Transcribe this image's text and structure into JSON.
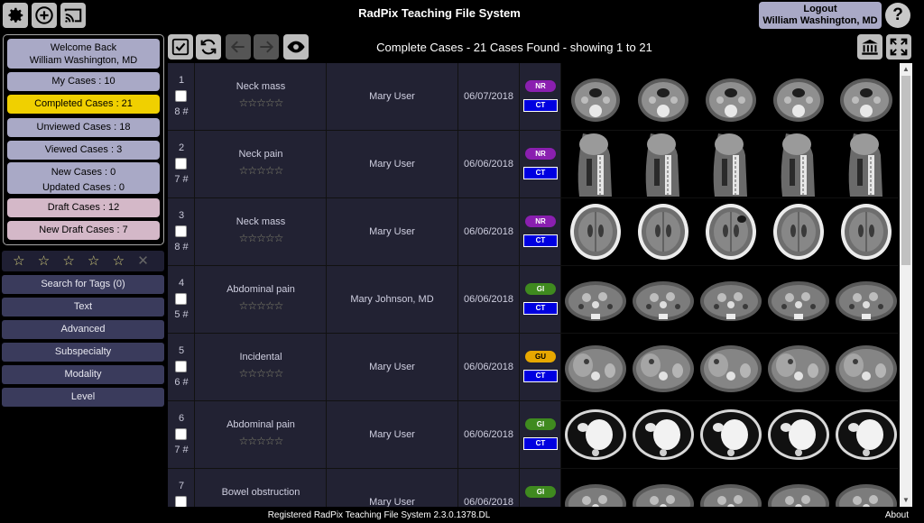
{
  "app": {
    "title": "RadPix Teaching File System"
  },
  "top_icons": [
    "gear-icon",
    "plus-circle-icon",
    "cast-icon"
  ],
  "user": {
    "logout_label": "Logout",
    "name": "William Washington, MD",
    "help_label": "?"
  },
  "sidebar": {
    "welcome": "Welcome Back",
    "welcome_name": "William Washington, MD",
    "my_cases": "My Cases : 10",
    "completed": "Completed Cases : 21",
    "unviewed": "Unviewed Cases : 18",
    "viewed": "Viewed Cases : 3",
    "new_cases": "New Cases : 0",
    "updated_cases": "Updated Cases : 0",
    "draft": "Draft Cases : 12",
    "new_draft": "New Draft Cases : 7",
    "stars": "☆ ☆ ☆ ☆ ☆",
    "clear": "✕",
    "filters": [
      "Search for Tags (0)",
      "Text",
      "Advanced",
      "Subspecialty",
      "Modality",
      "Level"
    ]
  },
  "toolbar": {
    "header": "Complete Cases - 21 Cases Found - showing 1 to 21",
    "icons": [
      "checkbox-icon",
      "refresh-icon",
      "arrow-left-icon",
      "arrow-right-icon",
      "eye-icon",
      "library-icon",
      "fullscreen-icon"
    ]
  },
  "colors": {
    "NR": "#8a1fb0",
    "GI": "#3f8a1f",
    "GU": "#e8a800",
    "modality": "#0000e0",
    "active": "#f0d000"
  },
  "cases": [
    {
      "num": "1",
      "count": "8 #",
      "title": "Neck mass",
      "rating": "☆☆☆☆☆",
      "user": "Mary User",
      "date": "06/07/2018",
      "tag": "NR",
      "modality": "CT",
      "thumb": "neck-axial"
    },
    {
      "num": "2",
      "count": "7 #",
      "title": "Neck pain",
      "rating": "☆☆☆☆☆",
      "user": "Mary User",
      "date": "06/06/2018",
      "tag": "NR",
      "modality": "CT",
      "thumb": "spine-sagittal"
    },
    {
      "num": "3",
      "count": "8 #",
      "title": "Neck mass",
      "rating": "☆☆☆☆☆",
      "user": "Mary User",
      "date": "06/06/2018",
      "tag": "NR",
      "modality": "CT",
      "thumb": "head-axial"
    },
    {
      "num": "4",
      "count": "5 #",
      "title": "Abdominal pain",
      "rating": "☆☆☆☆☆",
      "user": "Mary Johnson, MD",
      "date": "06/06/2018",
      "tag": "GI",
      "modality": "CT",
      "thumb": "pelvis-axial"
    },
    {
      "num": "5",
      "count": "6 #",
      "title": "Incidental",
      "rating": "☆☆☆☆☆",
      "user": "Mary User",
      "date": "06/06/2018",
      "tag": "GU",
      "modality": "CT",
      "thumb": "abdomen-axial"
    },
    {
      "num": "6",
      "count": "7 #",
      "title": "Abdominal pain",
      "rating": "☆☆☆☆☆",
      "user": "Mary User",
      "date": "06/06/2018",
      "tag": "GI",
      "modality": "CT",
      "thumb": "chest-axial"
    },
    {
      "num": "7",
      "count": "",
      "title": "Bowel obstruction",
      "rating": "",
      "user": "Mary User",
      "date": "06/06/2018",
      "tag": "GI",
      "modality": "",
      "thumb": "pelvis-axial"
    }
  ],
  "footer": {
    "registered": "Registered RadPix Teaching File System 2.3.0.1378.DL",
    "about": "About"
  }
}
